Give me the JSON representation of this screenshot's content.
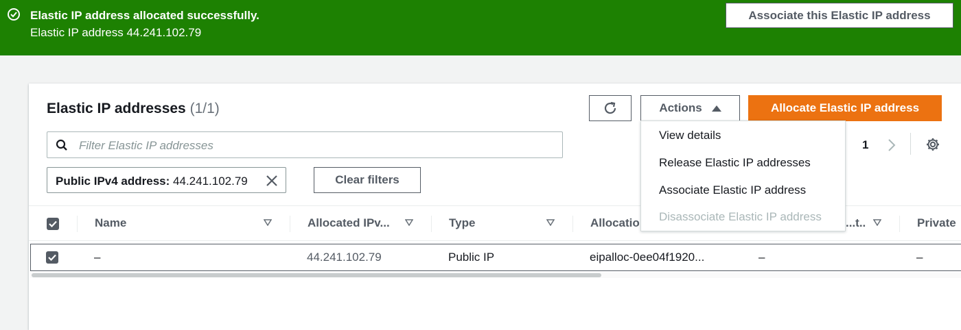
{
  "banner": {
    "title": "Elastic IP address allocated successfully.",
    "message": "Elastic IP address 44.241.102.79",
    "action_label": "Associate this Elastic IP address",
    "color": "#1d8102"
  },
  "panel": {
    "title": "Elastic IP addresses",
    "count": "(1/1)",
    "actions_label": "Actions",
    "allocate_label": "Allocate Elastic IP address",
    "accent_color": "#ec7211",
    "search_placeholder": "Filter Elastic IP addresses",
    "filter_token": {
      "key": "Public IPv4 address:",
      "value": "44.241.102.79"
    },
    "clear_filters_label": "Clear filters",
    "page_number": "1"
  },
  "actions_menu": [
    {
      "label": "View details",
      "enabled": true
    },
    {
      "label": "Release Elastic IP addresses",
      "enabled": true
    },
    {
      "label": "Associate Elastic IP address",
      "enabled": true
    },
    {
      "label": "Disassociate Elastic IP address",
      "enabled": false
    }
  ],
  "table": {
    "columns": [
      "Name",
      "Allocated IPv...",
      "Type",
      "Allocatio",
      "...t...",
      "Private"
    ],
    "rows": [
      {
        "name": "–",
        "ip": "44.241.102.79",
        "type": "Public IP",
        "allocation_id": "eipalloc-0ee04f1920...",
        "col5": "–",
        "private": "–",
        "selected": true
      }
    ]
  }
}
